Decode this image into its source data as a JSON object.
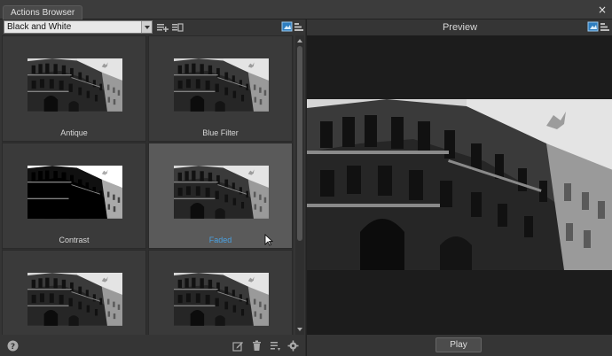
{
  "window": {
    "tab_title": "Actions Browser",
    "close_glyph": "×"
  },
  "toolbar": {
    "category_value": "Black and White",
    "icons": [
      "add-action-icon",
      "add-group-icon",
      "thumbnail-view-icon",
      "list-view-icon"
    ]
  },
  "actions": {
    "items": [
      {
        "label": "Antique",
        "selected": false
      },
      {
        "label": "Blue Filter",
        "selected": false
      },
      {
        "label": "Contrast",
        "selected": false
      },
      {
        "label": "Faded",
        "selected": true
      },
      {
        "label": "",
        "selected": false
      },
      {
        "label": "",
        "selected": false
      }
    ]
  },
  "bottom_bar": {
    "icons": [
      "help-icon",
      "edit-icon",
      "trash-icon",
      "reorder-icon",
      "gear-icon"
    ]
  },
  "preview": {
    "title": "Preview",
    "play_label": "Play",
    "icons": [
      "thumbnail-view-icon",
      "list-view-icon"
    ]
  },
  "colors": {
    "accent_selected_label": "#4aa0e0",
    "panel_bg": "#353535",
    "preview_bg": "#1c1c1c"
  }
}
